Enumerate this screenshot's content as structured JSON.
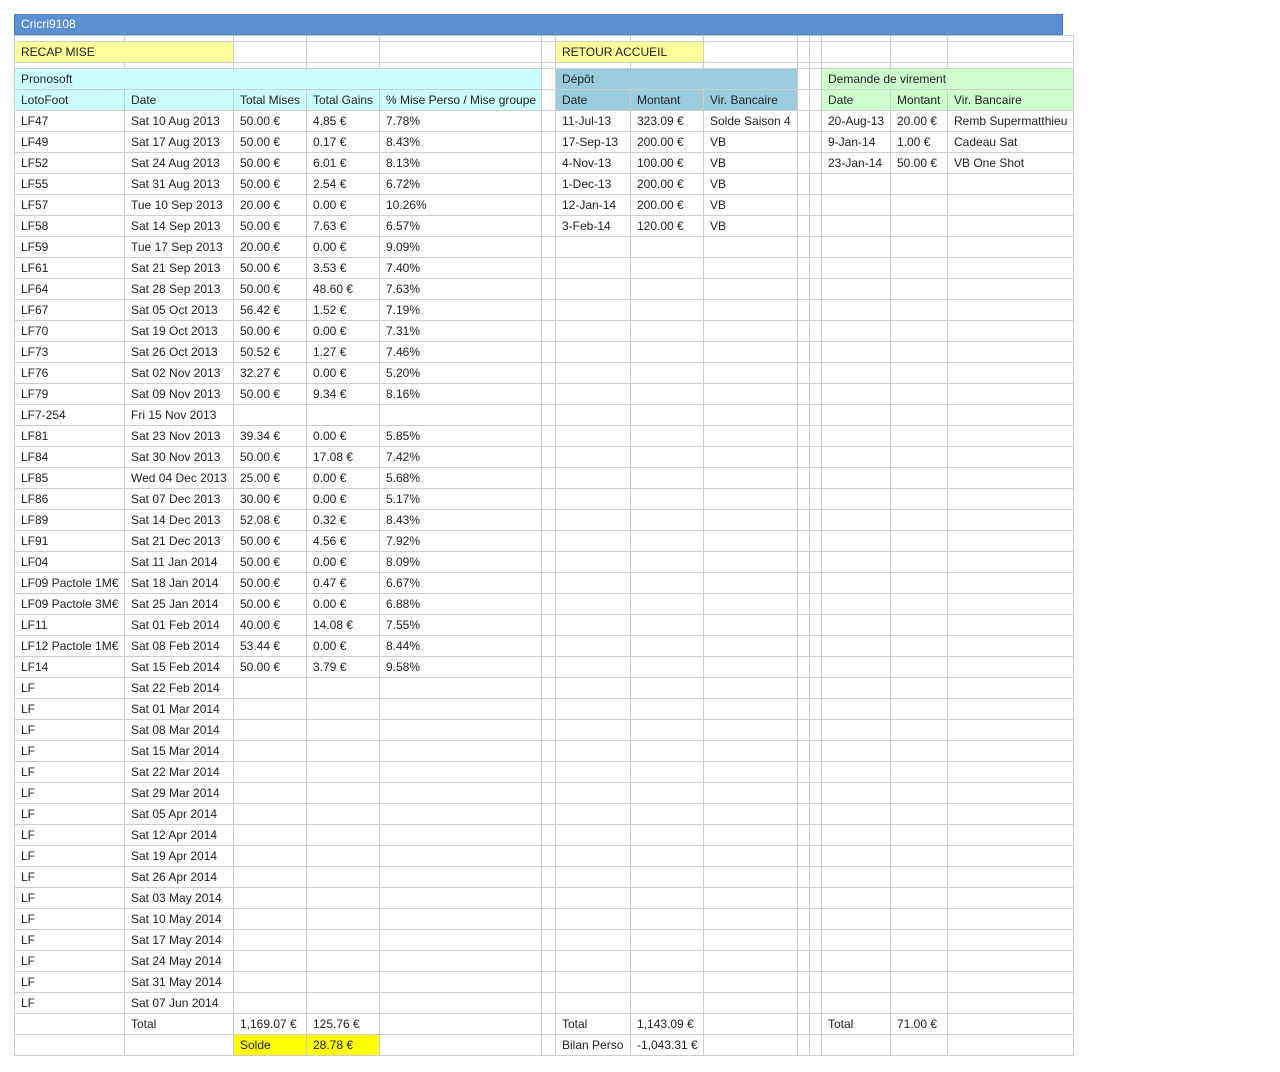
{
  "title": "Cricri9108",
  "links": {
    "recap": "RECAP MISE",
    "home": "RETOUR ACCUEIL"
  },
  "pronosoft": {
    "section": "Pronosoft",
    "headers": [
      "LotoFoot",
      "Date",
      "Total Mises",
      "Total Gains",
      "% Mise Perso / Mise groupe"
    ],
    "rows": [
      [
        "LF47",
        "Sat 10 Aug 2013",
        "50.00 €",
        "4.85 €",
        "7.78%"
      ],
      [
        "LF49",
        "Sat 17 Aug 2013",
        "50.00 €",
        "0.17 €",
        "8.43%"
      ],
      [
        "LF52",
        "Sat 24 Aug 2013",
        "50.00 €",
        "6.01 €",
        "8.13%"
      ],
      [
        "LF55",
        "Sat 31 Aug 2013",
        "50.00 €",
        "2.54 €",
        "6.72%"
      ],
      [
        "LF57",
        "Tue 10 Sep 2013",
        "20.00 €",
        "0.00 €",
        "10.26%"
      ],
      [
        "LF58",
        "Sat 14 Sep 2013",
        "50.00 €",
        "7.63 €",
        "6.57%"
      ],
      [
        "LF59",
        "Tue 17 Sep 2013",
        "20.00 €",
        "0.00 €",
        "9.09%"
      ],
      [
        "LF61",
        "Sat 21 Sep 2013",
        "50.00 €",
        "3.53 €",
        "7.40%"
      ],
      [
        "LF64",
        "Sat 28 Sep 2013",
        "50.00 €",
        "48.60 €",
        "7.63%"
      ],
      [
        "LF67",
        "Sat 05 Oct 2013",
        "56.42 €",
        "1.52 €",
        "7.19%"
      ],
      [
        "LF70",
        "Sat 19 Oct 2013",
        "50.00 €",
        "0.00 €",
        "7.31%"
      ],
      [
        "LF73",
        "Sat 26 Oct 2013",
        "50.52 €",
        "1.27 €",
        "7.46%"
      ],
      [
        "LF76",
        "Sat 02 Nov 2013",
        "32.27 €",
        "0.00 €",
        "5.20%"
      ],
      [
        "LF79",
        "Sat 09 Nov 2013",
        "50.00 €",
        "9.34 €",
        "8.16%"
      ],
      [
        "LF7-254",
        "Fri 15 Nov 2013",
        "",
        "",
        ""
      ],
      [
        "LF81",
        "Sat 23 Nov 2013",
        "39.34 €",
        "0.00 €",
        "5.85%"
      ],
      [
        "LF84",
        "Sat 30 Nov 2013",
        "50.00 €",
        "17.08 €",
        "7.42%"
      ],
      [
        "LF85",
        "Wed 04 Dec 2013",
        "25.00 €",
        "0.00 €",
        "5.68%"
      ],
      [
        "LF86",
        "Sat 07 Dec 2013",
        "30.00 €",
        "0.00 €",
        "5.17%"
      ],
      [
        "LF89",
        "Sat 14 Dec 2013",
        "52.08 €",
        "0.32 €",
        "8.43%"
      ],
      [
        "LF91",
        "Sat 21 Dec 2013",
        "50.00 €",
        "4.56 €",
        "7.92%"
      ],
      [
        "LF04",
        "Sat 11 Jan 2014",
        "50.00 €",
        "0.00 €",
        "8.09%"
      ],
      [
        "LF09 Pactole 1M€",
        "Sat 18 Jan 2014",
        "50.00 €",
        "0.47 €",
        "6.67%"
      ],
      [
        "LF09 Pactole 3M€",
        "Sat 25 Jan 2014",
        "50.00 €",
        "0.00 €",
        "6.88%"
      ],
      [
        "LF11",
        "Sat 01 Feb 2014",
        "40.00 €",
        "14.08 €",
        "7.55%"
      ],
      [
        "LF12 Pactole 1M€",
        "Sat 08 Feb 2014",
        "53.44 €",
        "0.00 €",
        "8.44%"
      ],
      [
        "LF14",
        "Sat 15 Feb 2014",
        "50.00 €",
        "3.79 €",
        "9.58%"
      ],
      [
        "LF",
        "Sat 22 Feb 2014",
        "",
        "",
        ""
      ],
      [
        "LF",
        "Sat 01 Mar 2014",
        "",
        "",
        ""
      ],
      [
        "LF",
        "Sat 08 Mar 2014",
        "",
        "",
        ""
      ],
      [
        "LF",
        "Sat 15 Mar 2014",
        "",
        "",
        ""
      ],
      [
        "LF",
        "Sat 22 Mar 2014",
        "",
        "",
        ""
      ],
      [
        "LF",
        "Sat 29 Mar 2014",
        "",
        "",
        ""
      ],
      [
        "LF",
        "Sat 05 Apr 2014",
        "",
        "",
        ""
      ],
      [
        "LF",
        "Sat 12 Apr 2014",
        "",
        "",
        ""
      ],
      [
        "LF",
        "Sat 19 Apr 2014",
        "",
        "",
        ""
      ],
      [
        "LF",
        "Sat 26 Apr 2014",
        "",
        "",
        ""
      ],
      [
        "LF",
        "Sat 03 May 2014",
        "",
        "",
        ""
      ],
      [
        "LF",
        "Sat 10 May 2014",
        "",
        "",
        ""
      ],
      [
        "LF",
        "Sat 17 May 2014",
        "",
        "",
        ""
      ],
      [
        "LF",
        "Sat 24 May 2014",
        "",
        "",
        ""
      ],
      [
        "LF",
        "Sat 31 May 2014",
        "",
        "",
        ""
      ],
      [
        "LF",
        "Sat 07 Jun 2014",
        "",
        "",
        ""
      ]
    ],
    "total_label": "Total",
    "total_mises": "1,169.07 €",
    "total_gains": "125.76 €",
    "solde_label": "Solde",
    "solde_value": "28.78 €"
  },
  "depot": {
    "section": "Dépôt",
    "headers": [
      "Date",
      "Montant",
      "Vir. Bancaire"
    ],
    "rows": [
      [
        "11-Jul-13",
        "323.09 €",
        "Solde Saison 4"
      ],
      [
        "17-Sep-13",
        "200.00 €",
        "VB"
      ],
      [
        "4-Nov-13",
        "100.00 €",
        "VB"
      ],
      [
        "1-Dec-13",
        "200.00 €",
        "VB"
      ],
      [
        "12-Jan-14",
        "200.00 €",
        "VB"
      ],
      [
        "3-Feb-14",
        "120.00 €",
        "VB"
      ]
    ],
    "total_label": "Total",
    "total_value": "1,143.09 €",
    "bilan_label": "Bilan Perso",
    "bilan_value": "-1,043.31 €"
  },
  "virement": {
    "section": "Demande de virement",
    "headers": [
      "Date",
      "Montant",
      "Vir. Bancaire"
    ],
    "rows": [
      [
        "20-Aug-13",
        "20.00 €",
        "Remb Supermatthieu"
      ],
      [
        "9-Jan-14",
        "1.00 €",
        "Cadeau Sat"
      ],
      [
        "23-Jan-14",
        "50.00 €",
        "VB One Shot"
      ]
    ],
    "total_label": "Total",
    "total_value": "71.00 €"
  },
  "colors": {
    "title_bar": "#5b8fd4",
    "link_cell": "#ffff99",
    "pronosoft_header": "#ccffff",
    "depot_header": "#99ccdd",
    "virement_header": "#ccffcc",
    "solde_highlight": "#ffff00"
  }
}
